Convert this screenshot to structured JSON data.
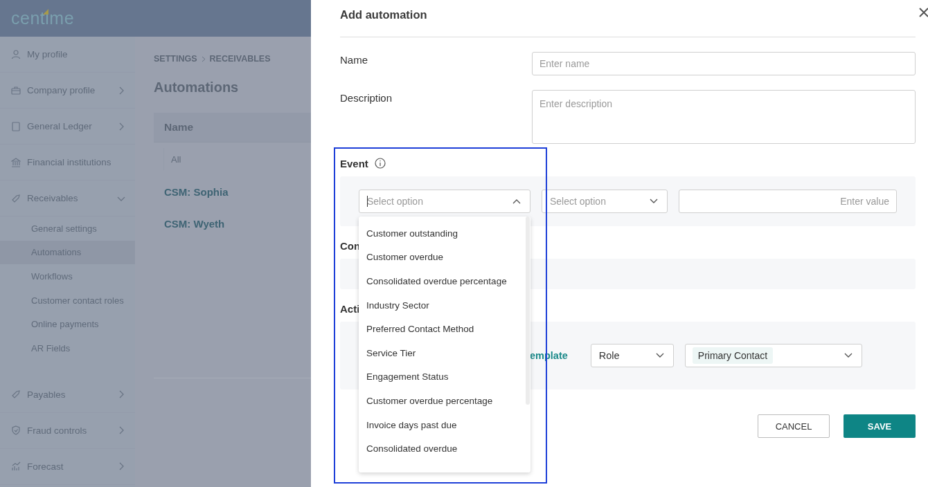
{
  "app": {
    "logo": "centime",
    "sidebar": {
      "items": [
        {
          "label": "My profile",
          "kind": "link"
        },
        {
          "label": "Company profile",
          "kind": "group",
          "expanded": false
        },
        {
          "label": "General Ledger",
          "kind": "group",
          "expanded": false
        },
        {
          "label": "Financial institutions",
          "kind": "link"
        },
        {
          "label": "Receivables",
          "kind": "group",
          "expanded": true,
          "children": [
            {
              "label": "General settings",
              "selected": false
            },
            {
              "label": "Automations",
              "selected": true
            },
            {
              "label": "Workflows",
              "selected": false
            },
            {
              "label": "Customer contact roles",
              "selected": false
            },
            {
              "label": "Online payments",
              "selected": false
            },
            {
              "label": "AR Fields",
              "selected": false
            }
          ]
        },
        {
          "label": "Payables",
          "kind": "group",
          "expanded": false
        },
        {
          "label": "Fraud controls",
          "kind": "group",
          "expanded": false
        },
        {
          "label": "Forecast",
          "kind": "group",
          "expanded": false
        }
      ]
    },
    "breadcrumb": [
      "SETTINGS",
      "RECEIVABLES"
    ],
    "page_title": "Automations",
    "table": {
      "column": "Name",
      "filter_placeholder": "All",
      "rows": [
        "CSM: Sophia",
        "CSM: Wyeth"
      ]
    }
  },
  "drawer": {
    "title": "Add automation",
    "name": {
      "label": "Name",
      "placeholder": "Enter name"
    },
    "description": {
      "label": "Description",
      "placeholder": "Enter description"
    },
    "event": {
      "label": "Event",
      "field_placeholder": "Select option",
      "expanded": true,
      "operator_placeholder": "Select option",
      "value_placeholder": "Enter value",
      "options": [
        "Customer outstanding",
        "Customer overdue",
        "Consolidated overdue percentage",
        "Industry Sector",
        "Preferred Contact Method",
        "Service Tier",
        "Engagement Status",
        "Customer overdue percentage",
        "Invoice days past due",
        "Consolidated overdue"
      ]
    },
    "conditions": {
      "label": "Con"
    },
    "actions": {
      "label": "Acti",
      "template_link": "emplate",
      "recipient_type": "Role",
      "recipient": "Primary Contact"
    },
    "buttons": {
      "cancel": "CANCEL",
      "save": "SAVE"
    }
  }
}
